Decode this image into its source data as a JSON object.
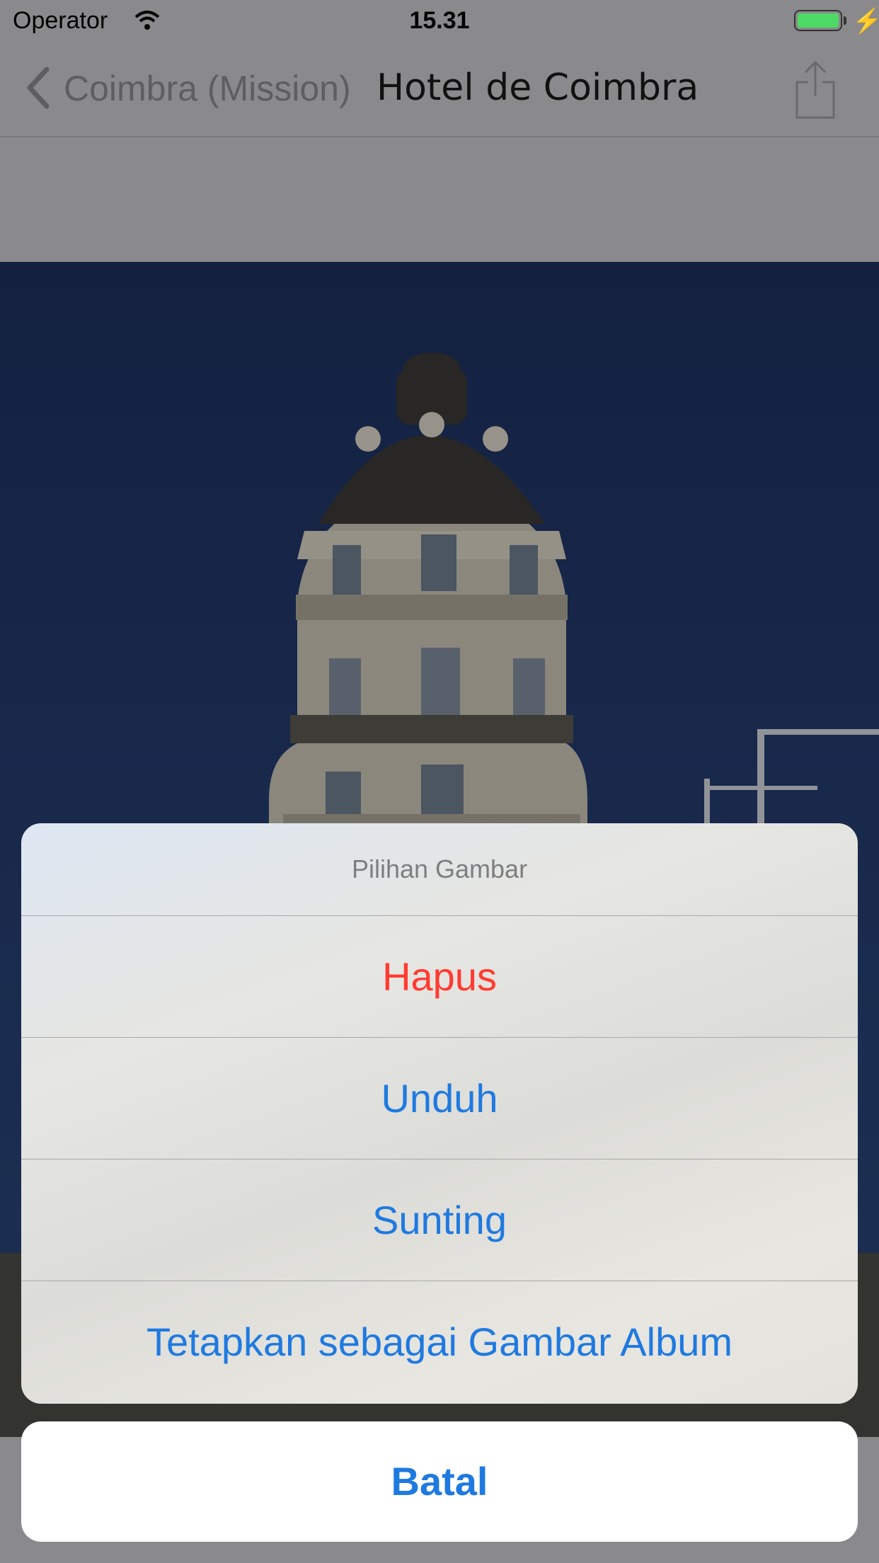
{
  "status_bar": {
    "operator": "Operator",
    "time": "15.31"
  },
  "nav": {
    "back_label": "Coimbra (Mission)",
    "title": "Hotel de Coimbra"
  },
  "action_sheet": {
    "title": "Pilihan Gambar",
    "items": [
      {
        "label": "Hapus",
        "style": "destructive",
        "color": "#ff3b30"
      },
      {
        "label": "Unduh",
        "color": "#1f7ae0"
      },
      {
        "label": "Sunting",
        "color": "#1f7ae0"
      },
      {
        "label": "Tetapkan sebagai Gambar Album",
        "color": "#1f7ae0"
      }
    ],
    "cancel_label": "Batal"
  },
  "icons": [
    "wifi-icon",
    "battery-icon",
    "charging-bolt-icon",
    "back-chevron-icon",
    "share-icon"
  ],
  "colors": {
    "accent": "#1f7ae0",
    "destructive": "#ff3b30",
    "battery": "#4cd964"
  }
}
